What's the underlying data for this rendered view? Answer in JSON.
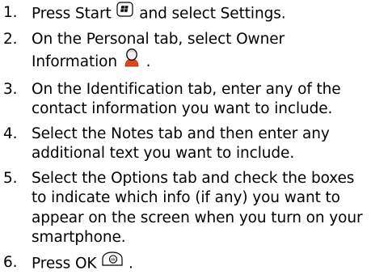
{
  "steps": [
    {
      "number": "1.",
      "before": "Press Start",
      "icon": "windows-start-key-icon",
      "after": "and select Settings."
    },
    {
      "number": "2.",
      "before": "On the Personal tab, select Owner Information",
      "icon": "owner-information-icon",
      "after": "."
    },
    {
      "number": "3.",
      "text": "On the Identification tab, enter any of the contact information you want to include."
    },
    {
      "number": "4.",
      "text": "Select the Notes tab and then enter any additional text you want to include."
    },
    {
      "number": "5.",
      "text": "Select the Options tab and check the boxes to indicate which info (if any) you want to appear on the screen when you turn on your smartphone."
    },
    {
      "number": "6.",
      "before": "Press OK",
      "icon": "ok-key-icon",
      "after": "."
    }
  ]
}
